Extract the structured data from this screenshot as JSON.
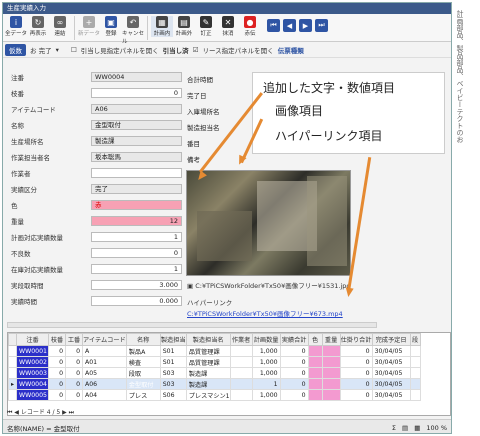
{
  "window": {
    "title": "生産実績入力"
  },
  "ribbon": {
    "buttons": [
      {
        "label": "全データ",
        "icon": "info-icon"
      },
      {
        "label": "再表示",
        "icon": "refresh-icon"
      },
      {
        "label": "連結",
        "icon": "link-icon"
      },
      {
        "label": "新データ",
        "icon": "plus-icon"
      },
      {
        "label": "登録",
        "icon": "save-icon"
      },
      {
        "label": "キャンセル",
        "icon": "undo-icon"
      },
      {
        "label": "計画内",
        "icon": "calendar-icon"
      },
      {
        "label": "計画外",
        "icon": "table-icon"
      },
      {
        "label": "訂正",
        "icon": "pencil-icon"
      },
      {
        "label": "抹消",
        "icon": "delete-icon"
      },
      {
        "label": "赤伝",
        "icon": "dot-icon"
      }
    ]
  },
  "toolbar2": {
    "tag": "仮数",
    "status": "お 完了",
    "link1": "引当し見指定パネルを開く",
    "link2": "引当し済",
    "link3": "リース指定パネルを開く",
    "link4": "伝票種類"
  },
  "form_left": [
    {
      "label": "注番",
      "value": "WW0004"
    },
    {
      "label": "枝番",
      "value": "0"
    },
    {
      "label": "アイテムコード",
      "value": "A06"
    },
    {
      "label": "名称",
      "value": "金型取付"
    },
    {
      "label": "生産場所名",
      "value": "製造課"
    },
    {
      "label": "作業担当者名",
      "value": "坂本聡馬"
    },
    {
      "label": "作業者",
      "value": ""
    },
    {
      "label": "実績区分",
      "value": "完了"
    },
    {
      "label": "色",
      "value": "赤"
    },
    {
      "label": "重量",
      "value": "12"
    },
    {
      "label": "計画対応実績数量",
      "value": "1"
    },
    {
      "label": "不良数",
      "value": "0"
    },
    {
      "label": "在庫対応実績数量",
      "value": "1"
    },
    {
      "label": "実段取時間",
      "value": "3.000"
    },
    {
      "label": "実績時間",
      "value": "0.000"
    }
  ],
  "form_right_labels": [
    "合計時間",
    "完了日",
    "入庫場所名",
    "製造担当名",
    "番目",
    "備考"
  ],
  "callout": {
    "line1": "追加した文字・数値項目",
    "line2": "画像項目",
    "line3": "ハイパーリンク項目"
  },
  "image": {
    "caption": "C:¥TPiCSWorkFolder¥Tx50¥画像フリー¥1531.jpg"
  },
  "hyperlink": {
    "label": "ハイパーリンク",
    "url": "C:¥TPiCSWorkFolder¥Tx50¥画像フリー¥673.mp4"
  },
  "grid": {
    "headers": [
      "注番",
      "枝番",
      "工番",
      "アイテムコード",
      "名称",
      "製造担当",
      "製造担当名",
      "作業者",
      "計画数量",
      "実績合計",
      "色",
      "重量",
      "仕掛り合計",
      "完成予定日",
      "段"
    ],
    "rows": [
      [
        "WW0001",
        "0",
        "0",
        "A",
        "製品A",
        "S01",
        "品質管理課",
        "",
        "1,000",
        "0",
        "",
        "",
        "0",
        "30/04/05",
        ""
      ],
      [
        "WW0002",
        "0",
        "0",
        "A01",
        "検査",
        "S01",
        "品質管理課",
        "",
        "1,000",
        "0",
        "",
        "",
        "0",
        "30/04/05",
        ""
      ],
      [
        "WW0003",
        "0",
        "0",
        "A05",
        "段取",
        "S03",
        "製造課",
        "",
        "1,000",
        "0",
        "",
        "",
        "0",
        "30/04/05",
        ""
      ],
      [
        "WW0004",
        "0",
        "0",
        "A06",
        "金型取付",
        "S03",
        "製造課",
        "",
        "1",
        "0",
        "",
        "",
        "0",
        "30/04/05",
        ""
      ],
      [
        "WW0005",
        "0",
        "0",
        "A04",
        "プレス",
        "S06",
        "プレスマシン1",
        "",
        "1,000",
        "0",
        "",
        "",
        "0",
        "30/04/05",
        ""
      ]
    ],
    "record_nav": "レコード 4 / 5"
  },
  "status": {
    "text": "名称(NAME) = 金型取付",
    "zoom": "100 %"
  },
  "side_text": "計画部品、製品部品、ベイビーテクトのお"
}
